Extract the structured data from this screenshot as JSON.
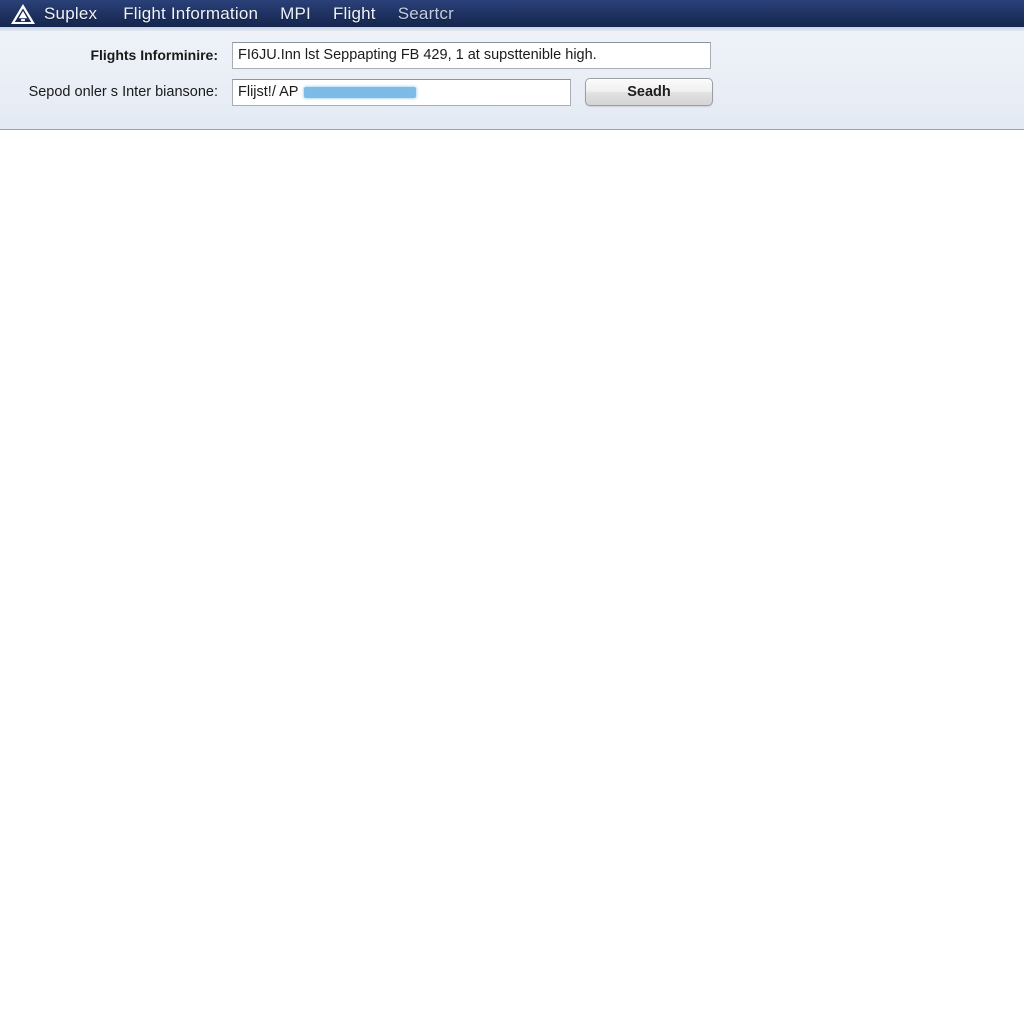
{
  "navbar": {
    "logo_icon": "triangle-warning-logo-icon",
    "items": [
      {
        "label": "Suplex",
        "kind": "brand"
      },
      {
        "label": "Flight Information",
        "kind": "link"
      },
      {
        "label": "MPI",
        "kind": "link"
      },
      {
        "label": "Flight",
        "kind": "link"
      },
      {
        "label": "Seartcr",
        "kind": "link-dim"
      }
    ],
    "background_color": "#213567"
  },
  "search_form": {
    "rows": [
      {
        "label": "Flights Informinire:",
        "value": "FI6JU.Inn lst Seppapting FB 429, 1 at supsttenible high.",
        "placeholder": "Flights Informinire"
      },
      {
        "label": "Sepod onler s Inter biansone:",
        "value": "Flijst!/ AP",
        "placeholder": "Sepod onler s Inter biansone",
        "redaction_color": "#7cbbe8"
      }
    ],
    "submit_label": "Seadh",
    "panel_color": "#e9eef6"
  },
  "content": {
    "body_color": "#ffffff"
  }
}
